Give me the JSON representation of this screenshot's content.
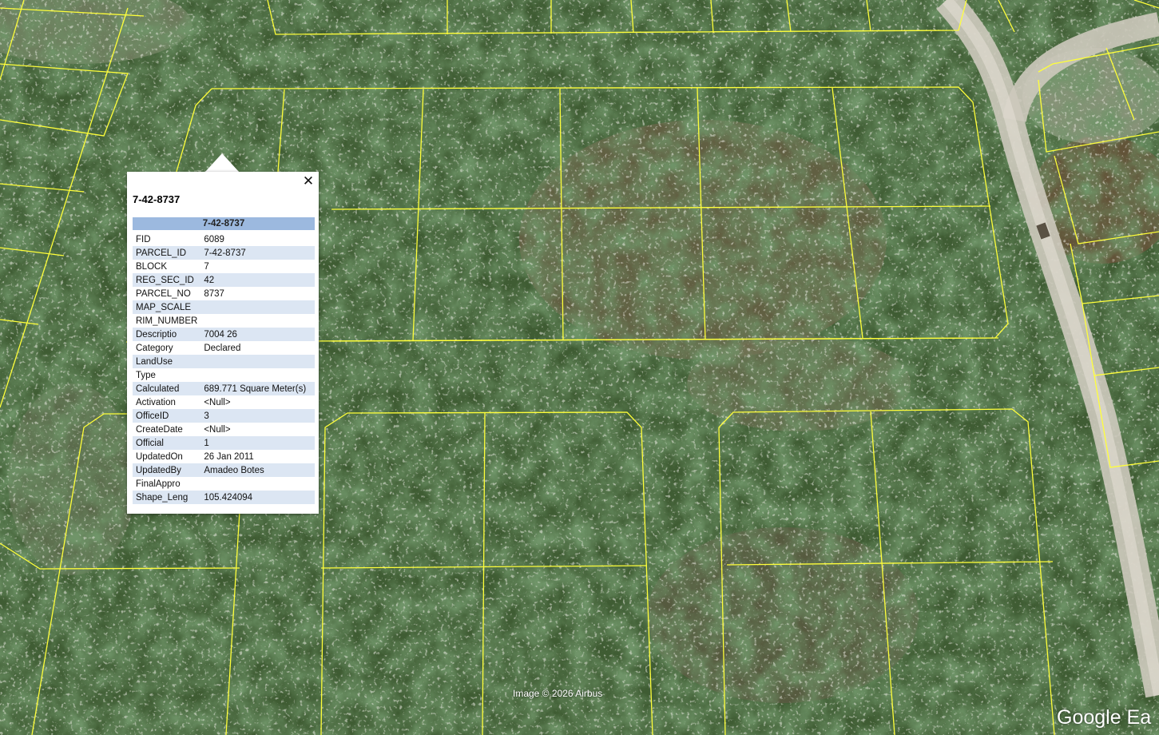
{
  "map": {
    "type": "satellite-imagery",
    "parcel_line_color": "#ffff3a",
    "road_color": "#c9c6bb"
  },
  "popup": {
    "title": "7-42-8737",
    "table_header": "7-42-8737",
    "close_icon": "close-icon",
    "rows": [
      {
        "key": "FID",
        "value": "6089"
      },
      {
        "key": "PARCEL_ID",
        "value": "7-42-8737"
      },
      {
        "key": "BLOCK",
        "value": "7"
      },
      {
        "key": "REG_SEC_ID",
        "value": "42"
      },
      {
        "key": "PARCEL_NO",
        "value": "8737"
      },
      {
        "key": "MAP_SCALE",
        "value": ""
      },
      {
        "key": "RIM_NUMBER",
        "value": ""
      },
      {
        "key": "Descriptio",
        "value": "7004 26"
      },
      {
        "key": "Category",
        "value": "Declared"
      },
      {
        "key": "LandUse",
        "value": ""
      },
      {
        "key": "Type",
        "value": ""
      },
      {
        "key": "Calculated",
        "value": "689.771 Square Meter(s)"
      },
      {
        "key": "Activation",
        "value": "<Null>"
      },
      {
        "key": "OfficeID",
        "value": "3"
      },
      {
        "key": "CreateDate",
        "value": "<Null>"
      },
      {
        "key": "Official",
        "value": "1"
      },
      {
        "key": "UpdatedOn",
        "value": "26 Jan 2011"
      },
      {
        "key": "UpdatedBy",
        "value": "Amadeo Botes"
      },
      {
        "key": "FinalAppro",
        "value": ""
      },
      {
        "key": "Shape_Leng",
        "value": "105.424094"
      }
    ]
  },
  "attribution": "Image © 2026 Airbus",
  "logo": "Google Ea"
}
